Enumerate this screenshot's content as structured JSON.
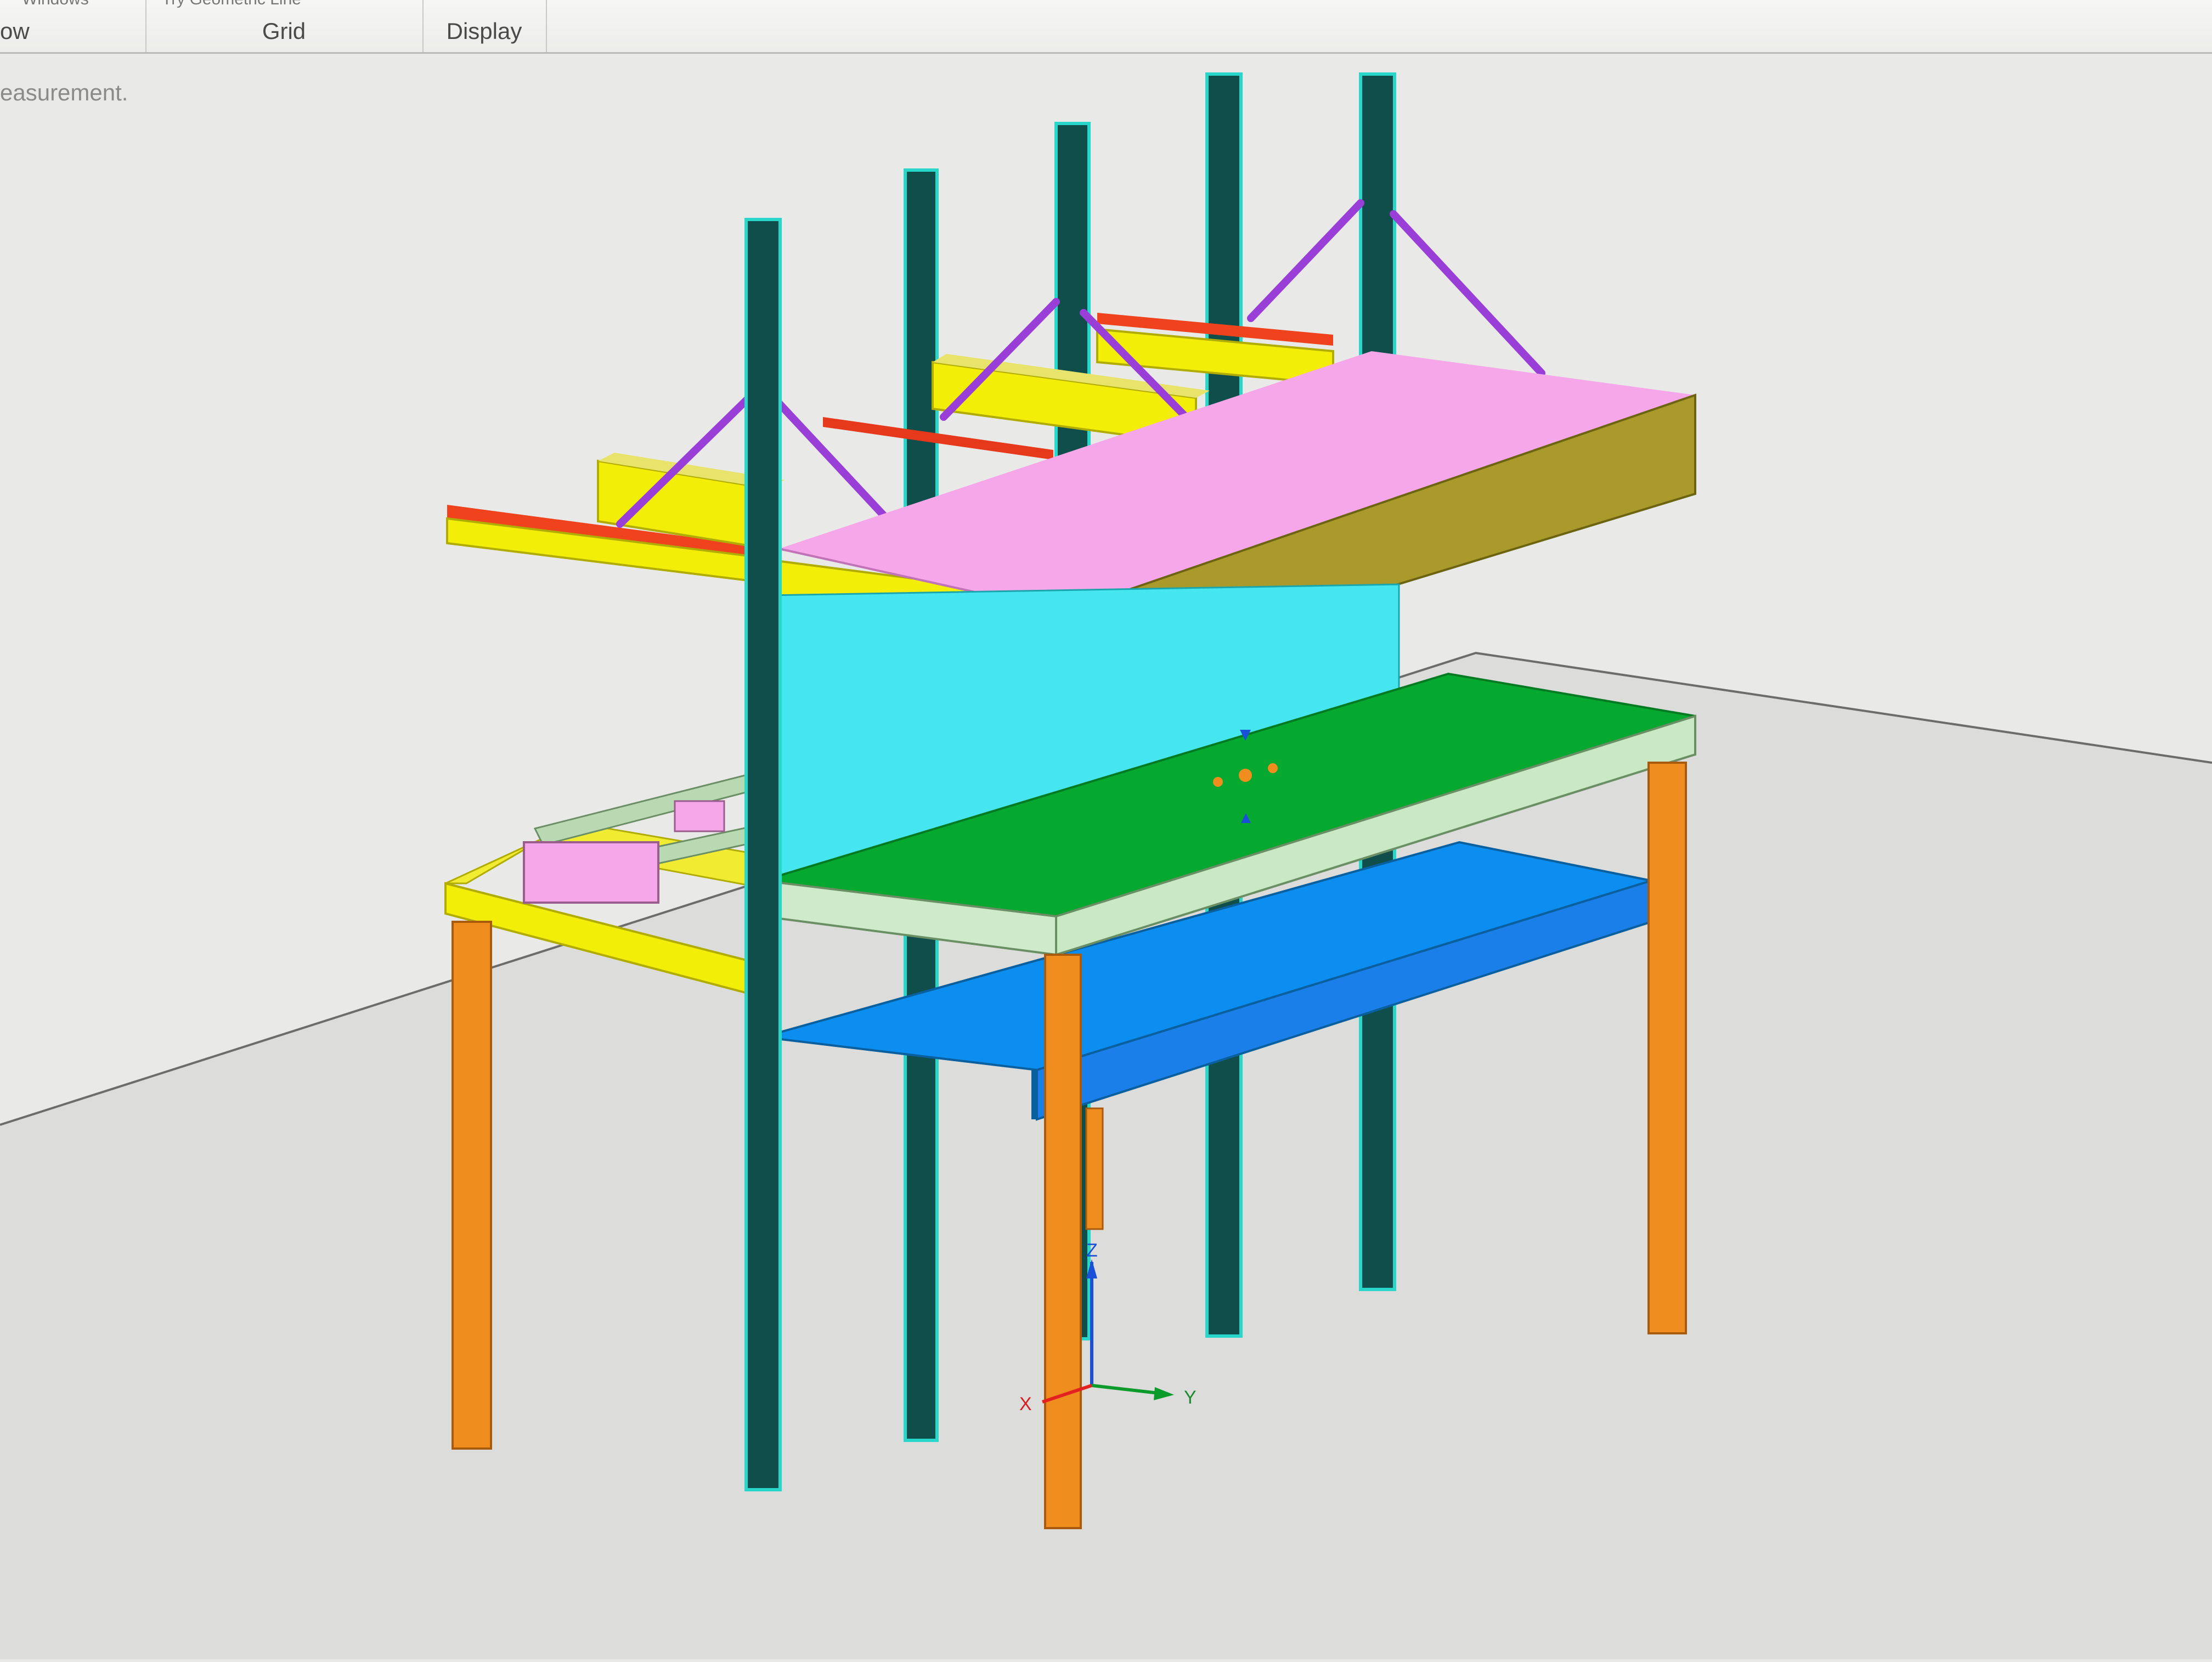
{
  "ribbon": {
    "groups": [
      {
        "label": "ow",
        "cut_top": "Windows"
      },
      {
        "label": "Grid",
        "cut_top": "Try Geometric Line"
      },
      {
        "label": "Display",
        "cut_top": ""
      }
    ]
  },
  "status_text": "easurement.",
  "triad": {
    "x": "X",
    "y": "Y",
    "z": "Z"
  },
  "colors": {
    "background": "#e9e9e7",
    "floor": "#dcdcda",
    "uprights": "#0f4e4a",
    "uprights_edge": "#28d7c9",
    "pink_shelf": "#f6a7e9",
    "shelf_edge": "#a99a2b",
    "cyan_panel": "#45e6ef",
    "green_top": "#05a92f",
    "blue_shelf": "#0b8eef",
    "legs": "#f08d1f",
    "yellow_frame": "#f3ee07",
    "red_rail": "#f0431d",
    "purple_brace": "#9a3ed8"
  }
}
